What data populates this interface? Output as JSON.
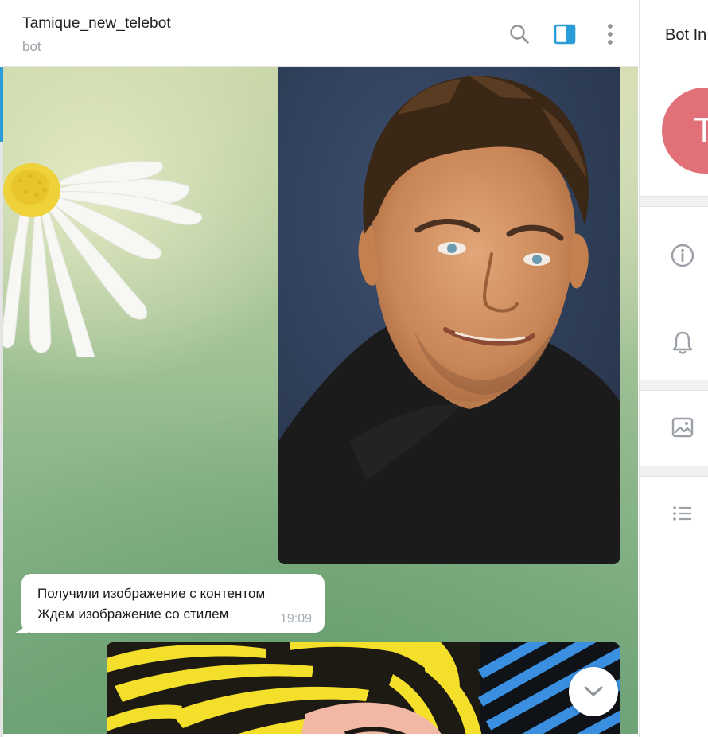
{
  "header": {
    "title": "Tamique_new_telebot",
    "subtitle": "bot",
    "icons": [
      "search-icon",
      "sidebar-toggle-icon",
      "more-vertical-icon"
    ],
    "accent_color": "#2a9cd8"
  },
  "messages": [
    {
      "type": "photo",
      "description": "portrait photo"
    },
    {
      "type": "text",
      "lines": [
        "Получили изображение с контентом",
        "Ждем изображение со стилем"
      ],
      "time": "19:09"
    },
    {
      "type": "photo",
      "description": "pop-art style image"
    }
  ],
  "scroll_down_icon": "chevron-down-icon",
  "info_panel": {
    "title": "Bot In",
    "avatar_letter": "T",
    "avatar_color": "#e17078",
    "icons": [
      "info-icon",
      "bell-icon",
      "image-icon",
      "list-icon"
    ]
  }
}
